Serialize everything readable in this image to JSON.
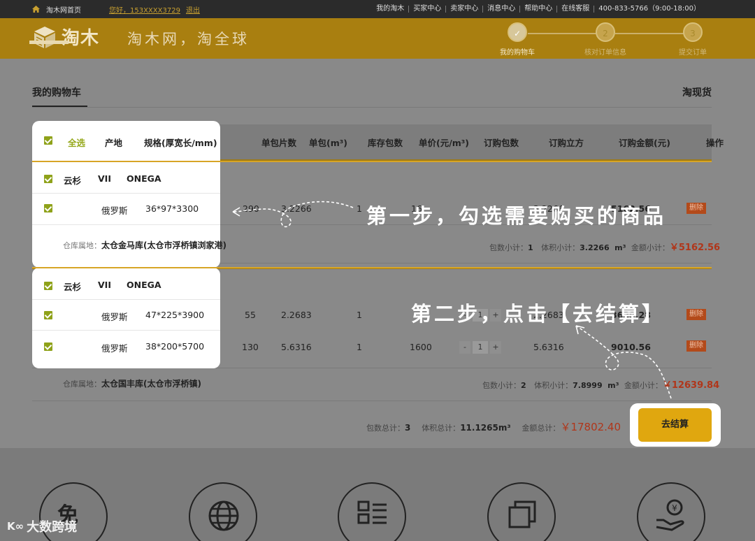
{
  "topbar": {
    "home_link": "淘木网首页",
    "greeting": "您好，153XXXX3729",
    "logout": "退出",
    "links": [
      "我的淘木",
      "买家中心",
      "卖家中心",
      "消息中心",
      "帮助中心",
      "在线客服",
      "400-833-5766（9:00-18:00）"
    ]
  },
  "header": {
    "logo_text": "淘木",
    "slogan": "淘木网，淘全球",
    "steps": [
      {
        "num": "",
        "label": "我的购物车"
      },
      {
        "num": "2",
        "label": "核对订单信息"
      },
      {
        "num": "3",
        "label": "提交订单"
      }
    ]
  },
  "cart": {
    "title": "我的购物车",
    "spot_link": "淘现货",
    "headers": [
      "全选",
      "产地",
      "规格(厚宽长/mm)",
      "单包片数",
      "单包(m³)",
      "库存包数",
      "单价(元/m³)",
      "订购包数",
      "订购立方",
      "订购金额(元)",
      "操作"
    ],
    "groups": [
      {
        "species": "云杉",
        "grade": "VII",
        "brand": "ONEGA",
        "items": [
          {
            "origin": "俄罗斯",
            "spec": "36*97*3300",
            "pieces": "290",
            "volume": "3.2266",
            "stock": "1",
            "price": "16",
            "qty": "1",
            "order_volume": "3.2266",
            "amount": "5162.56",
            "delete": "删除"
          }
        ],
        "warehouse_label": "仓库属地：",
        "warehouse": "太仓金马库(太仓市浮桥镇浏家港)",
        "sub_pkg_label": "包数小计：",
        "sub_pkg": "1",
        "sub_vol_label": "体积小计：",
        "sub_vol": "3.2266",
        "sub_vol_unit": "m³",
        "sub_amt_label": "金额小计：",
        "sub_amt": "￥5162.56"
      },
      {
        "species": "云杉",
        "grade": "VII",
        "brand": "ONEGA",
        "items": [
          {
            "origin": "俄罗斯",
            "spec": "47*225*3900",
            "pieces": "55",
            "volume": "2.2683",
            "stock": "1",
            "price": "",
            "qty": "1",
            "order_volume": "2.2683",
            "amount": "3629.28",
            "delete": "删除"
          },
          {
            "origin": "俄罗斯",
            "spec": "38*200*5700",
            "pieces": "130",
            "volume": "5.6316",
            "stock": "1",
            "price": "1600",
            "qty": "1",
            "order_volume": "5.6316",
            "amount": "9010.56",
            "delete": "删除"
          }
        ],
        "warehouse_label": "仓库属地：",
        "warehouse": "太仓国丰库(太仓市浮桥镇)",
        "sub_pkg_label": "包数小计：",
        "sub_pkg": "2",
        "sub_vol_label": "体积小计：",
        "sub_vol": "7.8999",
        "sub_vol_unit": "m³",
        "sub_amt_label": "金额小计：",
        "sub_amt": "￥12639.84"
      }
    ],
    "total": {
      "pkg_label": "包数总计：",
      "pkg": "3",
      "vol_label": "体积总计：",
      "vol": "11.1265m³",
      "amt_label": "金额总计：",
      "amt": "￥17802.40"
    },
    "checkout": "去结算"
  },
  "annotations": {
    "step1": "第一步，勾选需要购买的商品",
    "step2": "第二步，点击【去结算】"
  },
  "features": [
    "tax-free-icon",
    "globe-icon",
    "list-icon",
    "copy-icon",
    "money-hand-icon"
  ],
  "feature_glyph": "免",
  "watermark": "大数跨境",
  "watermark_mark": "K∞",
  "colors": {
    "accent": "#e0a70f",
    "header": "#a97f10",
    "check": "#8fa21a",
    "delete": "#b34a1a",
    "price_red": "#b0361a"
  }
}
